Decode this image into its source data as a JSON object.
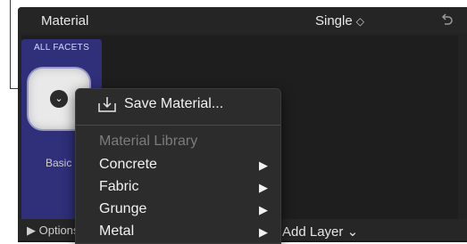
{
  "header": {
    "title": "Material",
    "mode": "Single",
    "mode_chevron": "◇"
  },
  "facet": {
    "label": "ALL FACETS",
    "name": "Basic"
  },
  "bottom": {
    "options": "Options",
    "add_layer": "Add Layer",
    "add_layer_chevron": "⌄"
  },
  "menu": {
    "save": "Save Material...",
    "library_heading": "Material Library",
    "items": [
      {
        "label": "Concrete",
        "arrow": "▶"
      },
      {
        "label": "Fabric",
        "arrow": "▶"
      },
      {
        "label": "Grunge",
        "arrow": "▶"
      },
      {
        "label": "Metal",
        "arrow": "▶"
      }
    ]
  },
  "colors": {
    "panel": "#232323",
    "facet_tile": "#2f2f7a",
    "menu": "#2c2c2c"
  }
}
